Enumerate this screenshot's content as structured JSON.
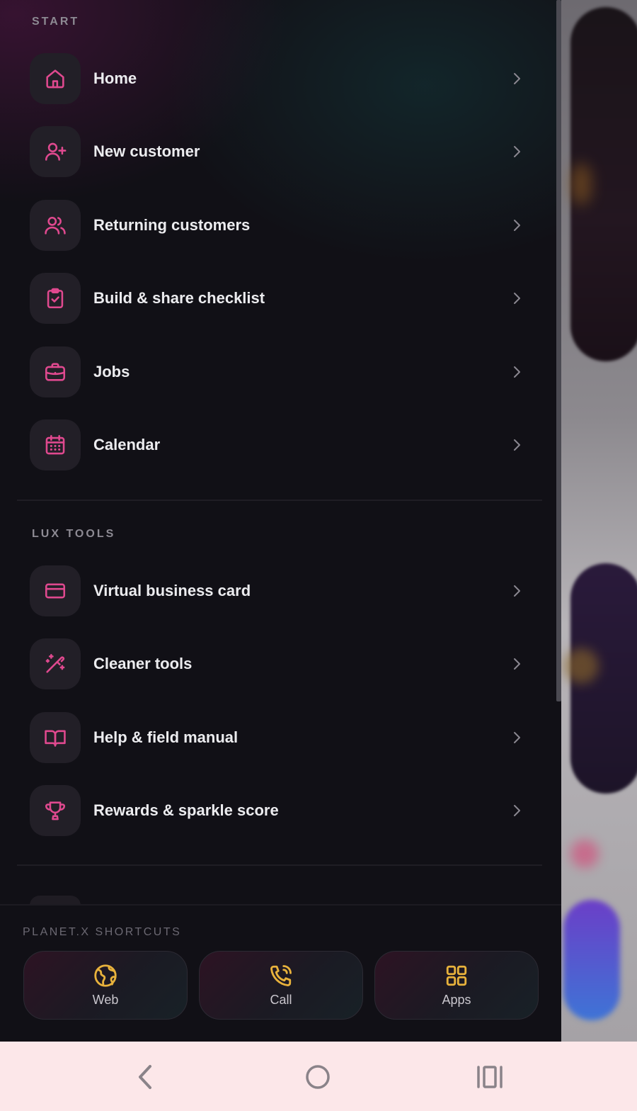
{
  "drawer": {
    "sections": [
      {
        "label": "START",
        "items": [
          {
            "label": "Home",
            "icon": "home-icon"
          },
          {
            "label": "New customer",
            "icon": "user-plus-icon"
          },
          {
            "label": "Returning customers",
            "icon": "users-icon"
          },
          {
            "label": "Build & share checklist",
            "icon": "clipboard-check-icon"
          },
          {
            "label": "Jobs",
            "icon": "briefcase-icon"
          },
          {
            "label": "Calendar",
            "icon": "calendar-icon"
          }
        ]
      },
      {
        "label": "LUX TOOLS",
        "items": [
          {
            "label": "Virtual business card",
            "icon": "credit-card-icon"
          },
          {
            "label": "Cleaner tools",
            "icon": "magic-wand-icon"
          },
          {
            "label": "Help & field manual",
            "icon": "book-open-icon"
          },
          {
            "label": "Rewards & sparkle score",
            "icon": "trophy-icon"
          }
        ]
      }
    ]
  },
  "shortcuts": {
    "label": "PLANET.X SHORTCUTS",
    "items": [
      {
        "label": "Web",
        "icon": "globe-icon"
      },
      {
        "label": "Call",
        "icon": "phone-call-icon"
      },
      {
        "label": "Apps",
        "icon": "grid-icon"
      }
    ]
  },
  "colors": {
    "accent_pink": "#e0498f",
    "accent_gold": "#e8b23c",
    "drawer_bg": "#111016",
    "navbar_bg": "#fce7e9"
  },
  "system_nav": {
    "buttons": [
      "back-icon",
      "home-circle-icon",
      "recents-icon"
    ]
  }
}
